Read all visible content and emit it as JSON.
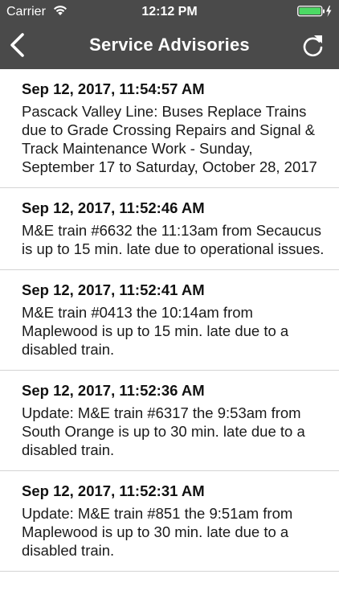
{
  "status_bar": {
    "carrier": "Carrier",
    "time": "12:12 PM",
    "battery_color": "#4cd964"
  },
  "nav": {
    "title": "Service Advisories",
    "back_icon": "chevron-left-icon",
    "refresh_icon": "refresh-icon",
    "background": "#4a4a4a"
  },
  "advisories": [
    {
      "date": "Sep 12, 2017, 11:54:57 AM",
      "text": "Pascack Valley Line: Buses Replace Trains due to Grade Crossing Repairs and Signal & Track Maintenance Work - Sunday, September 17 to Saturday, October 28, 2017"
    },
    {
      "date": "Sep 12, 2017, 11:52:46 AM",
      "text": "M&E train #6632 the 11:13am from Secaucus is up to 15 min. late due to operational issues."
    },
    {
      "date": "Sep 12, 2017, 11:52:41 AM",
      "text": "M&E train #0413 the 10:14am from Maplewood is up to 15 min. late due to a disabled train."
    },
    {
      "date": "Sep 12, 2017, 11:52:36 AM",
      "text": "Update: M&E train #6317 the 9:53am from South Orange is up to 30 min. late due to a disabled train."
    },
    {
      "date": "Sep 12, 2017, 11:52:31 AM",
      "text": "Update: M&E train #851 the 9:51am from Maplewood is up to 30 min. late due to a disabled train."
    }
  ]
}
